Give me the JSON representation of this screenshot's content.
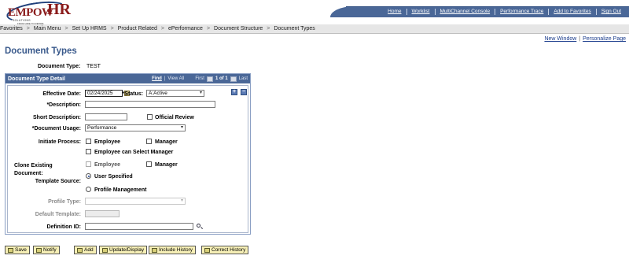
{
  "logo": {
    "brand_part1": "EMPOW",
    "brand_part2": "HR",
    "sub1": "SOLUTIONS",
    "sub2": "FROM HIRE TO RETIRE"
  },
  "top_nav": [
    "Home",
    "Worklist",
    "MultiChannel Console",
    "Performance Trace",
    "Add to Favorites",
    "Sign Out"
  ],
  "breadcrumb": [
    "Favorites",
    "Main Menu",
    "Set Up HRMS",
    "Product Related",
    "ePerformance",
    "Document Structure",
    "Document Types"
  ],
  "breadcrumb_separator": ">",
  "right_links": {
    "new_window": "New Window",
    "personalize": "Personalize Page"
  },
  "page_title": "Document Types",
  "document_type": {
    "label": "Document Type:",
    "value": "TEST"
  },
  "panel": {
    "title": "Document Type Detail",
    "find": "Find",
    "view_all": "View All",
    "first": "First",
    "count": "1 of 1",
    "last": "Last"
  },
  "form": {
    "effective_date": {
      "label": "Effective Date:",
      "value": "02/24/2025"
    },
    "status": {
      "label": "*Status:",
      "value": "A:Active"
    },
    "description": {
      "label": "*Description:",
      "value": ""
    },
    "short_description": {
      "label": "Short Description:",
      "value": ""
    },
    "official_review": {
      "label": "Official Review",
      "checked": false
    },
    "document_usage": {
      "label": "*Document Usage:",
      "value": "Performance"
    },
    "initiate_process": {
      "label": "Initiate Process:",
      "employee": "Employee",
      "manager": "Manager",
      "employee_select_manager": "Employee can Select Manager"
    },
    "clone_existing": {
      "label_line1": "Clone Existing",
      "label_line2": "Document:",
      "employee": "Employee",
      "manager": "Manager"
    },
    "template_source": {
      "label": "Template Source:",
      "user_specified": "User Specified",
      "profile_management": "Profile Management",
      "selected": "User Specified"
    },
    "profile_type": {
      "label": "Profile Type:",
      "value": ""
    },
    "default_template": {
      "label": "Default Template:",
      "value": ""
    },
    "definition_id": {
      "label": "Definition ID:",
      "value": ""
    }
  },
  "buttons": [
    "Save",
    "Notify",
    "Add",
    "Update/Display",
    "Include History",
    "Correct History"
  ],
  "colors": {
    "header_blue": "#4a6797",
    "title_blue": "#3a5a8c",
    "link_blue": "#1a3c8c",
    "button_yellow": "#f6efb6",
    "logo_red": "#8a1b1b"
  }
}
